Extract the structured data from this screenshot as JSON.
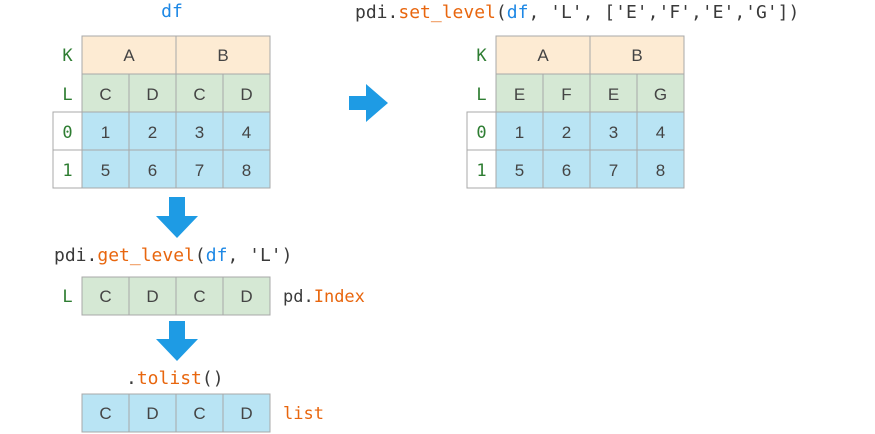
{
  "colors": {
    "level0_fill": "#fdebd3",
    "level1_fill": "#d5e8d4",
    "data_fill": "#b9e4f4",
    "grid": "#a8a8a8",
    "index_label": "#2e7d32",
    "func_orange": "#e8660e",
    "var_blue": "#1e88e5",
    "arrow_blue": "#1e9be4",
    "text_dark": "#3a3a3a"
  },
  "top_left": {
    "title": "df",
    "row_labels": [
      "K",
      "L",
      "0",
      "1"
    ],
    "level0": [
      "A",
      "B"
    ],
    "level1": [
      "C",
      "D",
      "C",
      "D"
    ],
    "rows": [
      [
        "1",
        "2",
        "3",
        "4"
      ],
      [
        "5",
        "6",
        "7",
        "8"
      ]
    ]
  },
  "top_right": {
    "code": {
      "prefix": "pdi.",
      "func": "set_level",
      "paren_open": "(",
      "var": "df",
      "args": ", 'L', ['E','F','E','G'])"
    },
    "row_labels": [
      "K",
      "L",
      "0",
      "1"
    ],
    "level0": [
      "A",
      "B"
    ],
    "level1": [
      "E",
      "F",
      "E",
      "G"
    ],
    "rows": [
      [
        "1",
        "2",
        "3",
        "4"
      ],
      [
        "5",
        "6",
        "7",
        "8"
      ]
    ]
  },
  "get_level": {
    "code": {
      "prefix": "pdi.",
      "func": "get_level",
      "paren_open": "(",
      "var": "df",
      "args": ", 'L')"
    },
    "row_label": "L",
    "values": [
      "C",
      "D",
      "C",
      "D"
    ],
    "type_prefix": "pd.",
    "type_name": "Index"
  },
  "tolist": {
    "code": {
      "dot": ".",
      "func": "tolist",
      "parens": "()"
    },
    "values": [
      "C",
      "D",
      "C",
      "D"
    ],
    "type_name": "list"
  },
  "icons": {
    "arrow_right": "arrow-right-icon",
    "arrow_down_1": "arrow-down-icon",
    "arrow_down_2": "arrow-down-icon"
  }
}
